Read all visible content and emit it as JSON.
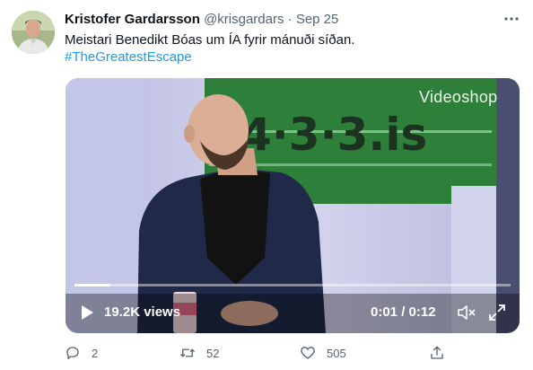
{
  "tweet": {
    "author_name": "Kristofer Gardarsson",
    "handle": "@krisgardars",
    "separator": "·",
    "date": "Sep 25",
    "text": "Meistari Benedikt Bóas um ÍA fyrir mánuði síðan.",
    "hashtag": "#TheGreatestEscape",
    "more_icon": "more-icon"
  },
  "video": {
    "watermark": "Videoshop",
    "background_logo": "4·3·3.is",
    "views": "19.2K views",
    "time": "0:01 / 0:12",
    "progress": 0.083,
    "icons": [
      "play-icon",
      "volume-icon",
      "fullscreen-icon"
    ]
  },
  "actions": {
    "reply_count": "2",
    "retweet_count": "52",
    "like_count": "505",
    "icons": [
      "reply-icon",
      "retweet-icon",
      "like-icon",
      "share-icon"
    ]
  },
  "colors": {
    "link": "#1d9bf0",
    "secondary_text": "#536471",
    "primary_text": "#0f1419"
  }
}
